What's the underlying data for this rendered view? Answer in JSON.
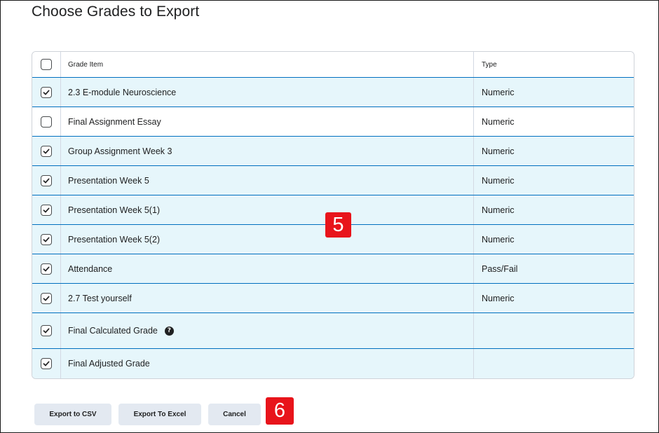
{
  "page": {
    "title": "Choose Grades to Export"
  },
  "table": {
    "headers": {
      "grade_item": "Grade Item",
      "type": "Type"
    },
    "rows": [
      {
        "name": "2.3 E-module Neuroscience",
        "type": "Numeric",
        "checked": true
      },
      {
        "name": "Final Assignment Essay",
        "type": "Numeric",
        "checked": false
      },
      {
        "name": "Group Assignment Week 3",
        "type": "Numeric",
        "checked": true
      },
      {
        "name": "Presentation Week 5",
        "type": "Numeric",
        "checked": true
      },
      {
        "name": "Presentation Week 5(1)",
        "type": "Numeric",
        "checked": true
      },
      {
        "name": "Presentation Week 5(2)",
        "type": "Numeric",
        "checked": true
      },
      {
        "name": "Attendance",
        "type": "Pass/Fail",
        "checked": true
      },
      {
        "name": "2.7 Test yourself",
        "type": "Numeric",
        "checked": true
      },
      {
        "name": "Final Calculated Grade",
        "type": "",
        "checked": true,
        "help": "?"
      },
      {
        "name": "Final Adjusted Grade",
        "type": "",
        "checked": true
      }
    ]
  },
  "buttons": {
    "export_csv": "Export to CSV",
    "export_excel": "Export To Excel",
    "cancel": "Cancel"
  },
  "annotations": {
    "step5": "5",
    "step6": "6"
  },
  "colors": {
    "selected_row": "#e6f6fb",
    "selected_border": "#006fbf",
    "badge": "#e8141b",
    "button_bg": "#e3e9f1"
  }
}
